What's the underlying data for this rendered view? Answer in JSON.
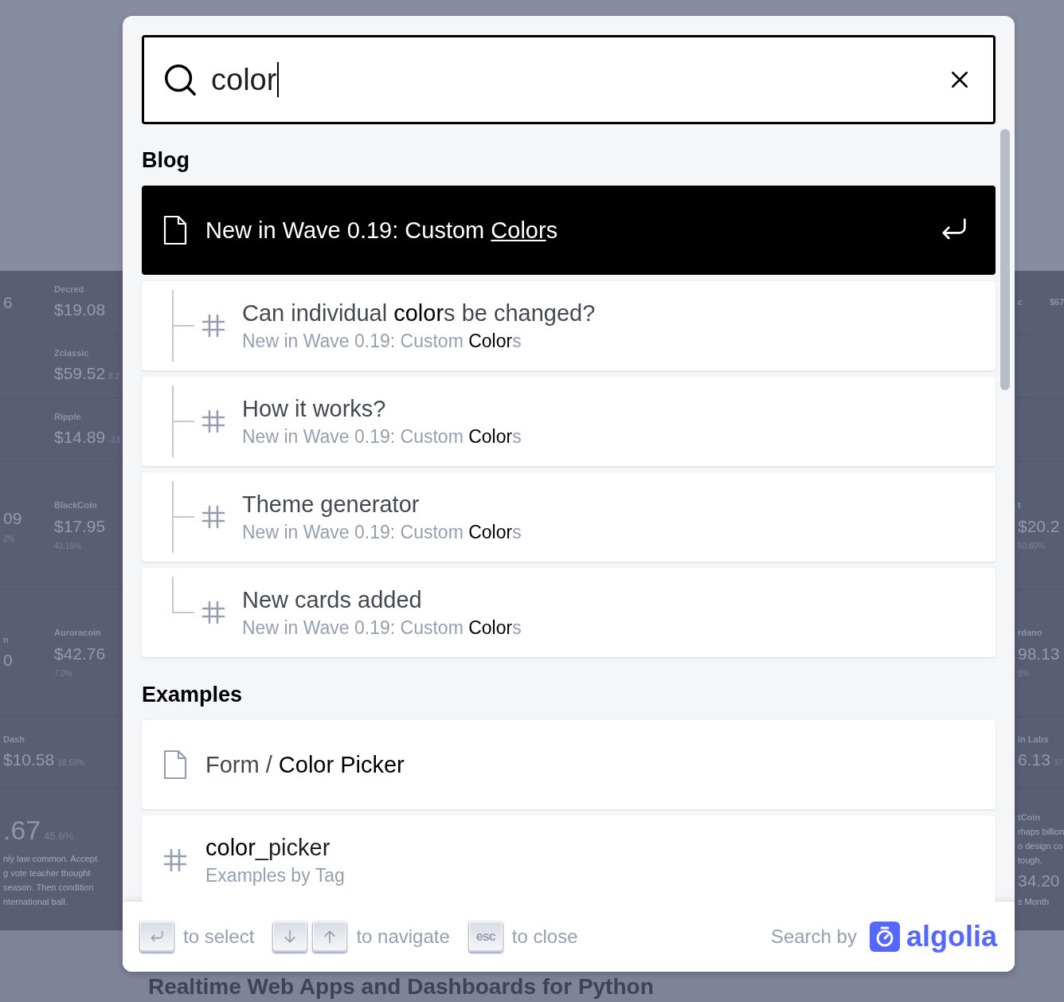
{
  "background": {
    "left_rows": [
      {
        "cells": [
          {
            "lines": [
              {
                "kind": "value",
                "text": "6"
              }
            ]
          },
          {
            "lines": [
              {
                "kind": "label",
                "text": "Decred"
              },
              {
                "kind": "value",
                "text": "$19.08"
              }
            ]
          }
        ]
      },
      {
        "cells": [
          {},
          {
            "lines": [
              {
                "kind": "label",
                "text": "Zclassic"
              },
              {
                "kind": "value",
                "text": "$59.52",
                "note": "8.2"
              }
            ]
          }
        ]
      },
      {
        "cells": [
          {},
          {
            "lines": [
              {
                "kind": "label",
                "text": "Ripple"
              },
              {
                "kind": "value",
                "text": "$14.89",
                "note": "-13."
              }
            ]
          }
        ]
      },
      {
        "cells": [
          {
            "lines": [
              {
                "kind": "value",
                "text": "09"
              },
              {
                "kind": "small",
                "text": "2%"
              }
            ]
          },
          {
            "lines": [
              {
                "kind": "label",
                "text": "BlackCoin"
              },
              {
                "kind": "value",
                "text": "$17.95"
              },
              {
                "kind": "small",
                "text": "43.16%"
              }
            ]
          }
        ]
      },
      {
        "cells": [
          {
            "lines": [
              {
                "kind": "label",
                "text": "n"
              },
              {
                "kind": "value",
                "text": "0"
              }
            ]
          },
          {
            "lines": [
              {
                "kind": "label",
                "text": "Auroracoin"
              },
              {
                "kind": "value",
                "text": "$42.76"
              },
              {
                "kind": "small",
                "text": "7.0%"
              }
            ]
          }
        ]
      },
      {
        "cells": [
          {
            "lines": [
              {
                "kind": "label",
                "text": "Dash"
              },
              {
                "kind": "value",
                "text": "$10.58",
                "note": "18.59%"
              }
            ]
          }
        ]
      },
      {
        "cells": [
          {
            "lines": [
              {
                "kind": "big",
                "text": ".67",
                "note": "45.6%"
              },
              {
                "kind": "text",
                "text": "nly law common. Accept"
              },
              {
                "kind": "text",
                "text": "g vote teacher thought"
              },
              {
                "kind": "text",
                "text": "season. Then condition"
              },
              {
                "kind": "text",
                "text": "nternational ball."
              }
            ]
          }
        ]
      }
    ],
    "right_rows": [
      {
        "cells": [
          {
            "lines": [
              {
                "kind": "label",
                "text": "c"
              }
            ]
          },
          {
            "lines": [
              {
                "kind": "label",
                "text": "$67"
              }
            ]
          }
        ]
      },
      {
        "cells": []
      },
      {
        "cells": []
      },
      {
        "cells": [
          {
            "lines": [
              {
                "kind": "label",
                "text": "t"
              },
              {
                "kind": "value",
                "text": "$20.2"
              },
              {
                "kind": "small",
                "text": "50.80%"
              }
            ]
          }
        ]
      },
      {
        "cells": [
          {
            "lines": [
              {
                "kind": "label",
                "text": "rdano"
              },
              {
                "kind": "value",
                "text": "98.13"
              },
              {
                "kind": "small",
                "text": "9%"
              }
            ]
          }
        ]
      },
      {
        "cells": [
          {
            "lines": [
              {
                "kind": "label",
                "text": "in Labs"
              },
              {
                "kind": "value",
                "text": "6.13",
                "note": "37"
              }
            ]
          }
        ]
      },
      {
        "cells": [
          {
            "lines": [
              {
                "kind": "label",
                "text": "tCoin"
              },
              {
                "kind": "text",
                "text": "rhaps billion"
              },
              {
                "kind": "text",
                "text": "o design co"
              },
              {
                "kind": "text",
                "text": "tough."
              },
              {
                "kind": "value",
                "text": "34.20"
              },
              {
                "kind": "text",
                "text": "s Month"
              }
            ]
          }
        ]
      }
    ],
    "heading": "Realtime Web Apps and Dashboards for Python"
  },
  "search": {
    "value": "color"
  },
  "sections": [
    {
      "title": "Blog",
      "hits": [
        {
          "kind": "page",
          "title": "New in Wave 0.19: Custom **Color**s",
          "selected": true
        },
        {
          "kind": "child",
          "last": false,
          "title": "Can individual **color**s be changed?",
          "path": "New in Wave 0.19: Custom **Color**s",
          "selected": false
        },
        {
          "kind": "child",
          "last": false,
          "title": "How it works?",
          "path": "New in Wave 0.19: Custom **Color**s",
          "selected": false
        },
        {
          "kind": "child",
          "last": false,
          "title": "Theme generator",
          "path": "New in Wave 0.19: Custom **Color**s",
          "selected": false
        },
        {
          "kind": "child",
          "last": true,
          "title": "New cards added",
          "path": "New in Wave 0.19: Custom **Color**s",
          "selected": false
        }
      ]
    },
    {
      "title": "Examples",
      "hits": [
        {
          "kind": "page",
          "title": "Form / **Color Picker**",
          "selected": false
        },
        {
          "kind": "heading",
          "title": "**color**_picker",
          "path": "Examples by Tag",
          "selected": false
        }
      ]
    }
  ],
  "footer": {
    "commands": [
      {
        "keys": [
          {
            "kind": "enter"
          }
        ],
        "label": "to select"
      },
      {
        "keys": [
          {
            "kind": "down"
          },
          {
            "kind": "up"
          }
        ],
        "label": "to navigate"
      },
      {
        "keys": [
          {
            "kind": "text",
            "text": "esc"
          }
        ],
        "label": "to close"
      }
    ],
    "search_by": "Search by",
    "logo": "algolia"
  }
}
